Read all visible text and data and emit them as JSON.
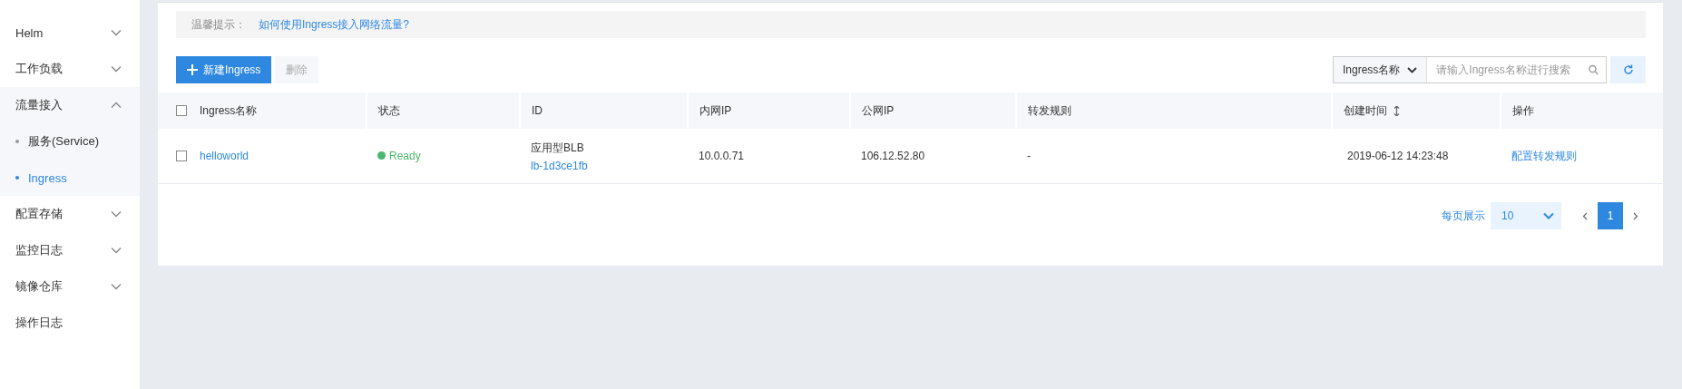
{
  "sidebar": {
    "items": [
      {
        "label": "Helm",
        "kind": "group",
        "expanded": false
      },
      {
        "label": "工作负载",
        "kind": "group",
        "expanded": false
      },
      {
        "label": "流量接入",
        "kind": "group",
        "expanded": true,
        "children": [
          {
            "label": "服务(Service)",
            "selected": false
          },
          {
            "label": "Ingress",
            "selected": true
          }
        ]
      },
      {
        "label": "配置存储",
        "kind": "group",
        "expanded": false
      },
      {
        "label": "监控日志",
        "kind": "group",
        "expanded": false
      },
      {
        "label": "镜像仓库",
        "kind": "group",
        "expanded": false
      },
      {
        "label": "操作日志",
        "kind": "link"
      }
    ]
  },
  "tip": {
    "label": "温馨提示：",
    "link": "如何使用Ingress接入网络流量?"
  },
  "toolbar": {
    "buttons": [
      {
        "label": "新建Ingress",
        "kind": "primary",
        "disabled": false
      },
      {
        "label": "删除",
        "kind": "plain",
        "disabled": true
      }
    ],
    "search": {
      "filter": "Ingress名称",
      "placeholder": "请输入Ingress名称进行搜索"
    }
  },
  "table": {
    "select_all_checked": false,
    "columns": [
      {
        "label": "Ingress名称",
        "sortable": false
      },
      {
        "label": "状态",
        "sortable": false
      },
      {
        "label": "ID",
        "sortable": false
      },
      {
        "label": "内网IP",
        "sortable": false
      },
      {
        "label": "公网IP",
        "sortable": false
      },
      {
        "label": "转发规则",
        "sortable": false
      },
      {
        "label": "创建时间",
        "sortable": true
      },
      {
        "label": "操作",
        "sortable": false
      }
    ],
    "rows": [
      {
        "checked": false,
        "name": "helloworld",
        "status": {
          "text": "Ready",
          "color": "#4cb86d"
        },
        "id_type": "应用型BLB",
        "id": "lb-1d3ce1fb",
        "private_ip": "10.0.0.71",
        "public_ip": "106.12.52.80",
        "rules": "-",
        "created": "2019-06-12 14:23:48",
        "action": "配置转发规则"
      }
    ]
  },
  "pagination": {
    "label": "每页展示",
    "page_size": "10",
    "pages": [
      {
        "label": "1",
        "selected": true
      }
    ]
  }
}
